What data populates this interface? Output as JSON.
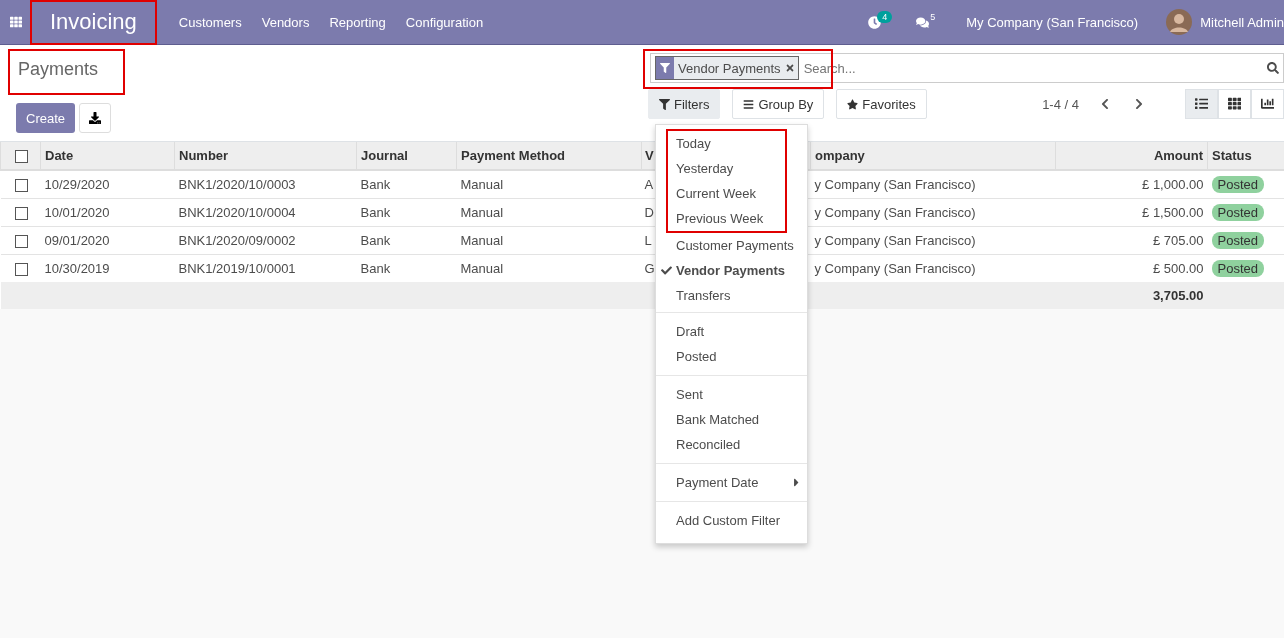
{
  "navbar": {
    "app_title": "Invoicing",
    "app_title_annotated": true,
    "menu": [
      "Customers",
      "Vendors",
      "Reporting",
      "Configuration"
    ],
    "activity_count": "4",
    "message_count": "5",
    "company": "My Company (San Francisco)",
    "user": "Mitchell Admin"
  },
  "control_panel": {
    "title": "Payments",
    "title_annotated": true,
    "create_label": "Create",
    "search": {
      "facet": "Vendor Payments",
      "placeholder": "Search...",
      "annotated": true
    },
    "filter_buttons": [
      {
        "label": "Filters",
        "selected": true
      },
      {
        "label": "Group By",
        "selected": false
      },
      {
        "label": "Favorites",
        "selected": false
      }
    ],
    "pager": "1-4 / 4",
    "views": [
      {
        "kind": "list",
        "selected": true
      },
      {
        "kind": "kanban",
        "selected": false
      },
      {
        "kind": "graph",
        "selected": false
      }
    ]
  },
  "table": {
    "all_selected": false,
    "columns": [
      "Date",
      "Number",
      "Journal",
      "Payment Method",
      "V",
      "ompany",
      "Amount",
      "Status"
    ],
    "rows": [
      {
        "checked": false,
        "cells": [
          "10/29/2020",
          "BNK1/2020/10/0003",
          "Bank",
          "Manual",
          "A",
          "y Company (San Francisco)",
          "£ 1,000.00"
        ],
        "status": "Posted"
      },
      {
        "checked": false,
        "cells": [
          "10/01/2020",
          "BNK1/2020/10/0004",
          "Bank",
          "Manual",
          "D",
          "y Company (San Francisco)",
          "£ 1,500.00"
        ],
        "status": "Posted"
      },
      {
        "checked": false,
        "cells": [
          "09/01/2020",
          "BNK1/2020/09/0002",
          "Bank",
          "Manual",
          "L",
          "y Company (San Francisco)",
          "£ 705.00"
        ],
        "status": "Posted"
      },
      {
        "checked": false,
        "cells": [
          "10/30/2019",
          "BNK1/2019/10/0001",
          "Bank",
          "Manual",
          "G",
          "y Company (San Francisco)",
          "£ 500.00"
        ],
        "status": "Posted"
      }
    ],
    "total": "3,705.00"
  },
  "filters_menu": {
    "groups": [
      {
        "items": [
          {
            "label": "Today",
            "checked": false,
            "highlighted": true
          },
          {
            "label": "Yesterday",
            "checked": false,
            "highlighted": true
          },
          {
            "label": "Current Week",
            "checked": false,
            "highlighted": true
          },
          {
            "label": "Previous Week",
            "checked": false,
            "highlighted": true
          },
          {
            "label": "Customer Payments",
            "checked": false,
            "highlighted": false
          },
          {
            "label": "Vendor Payments",
            "checked": true,
            "highlighted": false
          },
          {
            "label": "Transfers",
            "checked": false,
            "highlighted": false
          }
        ]
      },
      {
        "items": [
          {
            "label": "Draft",
            "checked": false,
            "highlighted": false
          },
          {
            "label": "Posted",
            "checked": false,
            "highlighted": false
          }
        ]
      },
      {
        "items": [
          {
            "label": "Sent",
            "checked": false,
            "highlighted": false
          },
          {
            "label": "Bank Matched",
            "checked": false,
            "highlighted": false
          },
          {
            "label": "Reconciled",
            "checked": false,
            "highlighted": false
          }
        ]
      },
      {
        "items": [
          {
            "label": "Payment Date",
            "checked": false,
            "highlighted": false,
            "submenu": true
          }
        ]
      },
      {
        "items": [
          {
            "label": "Add Custom Filter",
            "checked": false,
            "highlighted": false
          }
        ]
      }
    ]
  }
}
